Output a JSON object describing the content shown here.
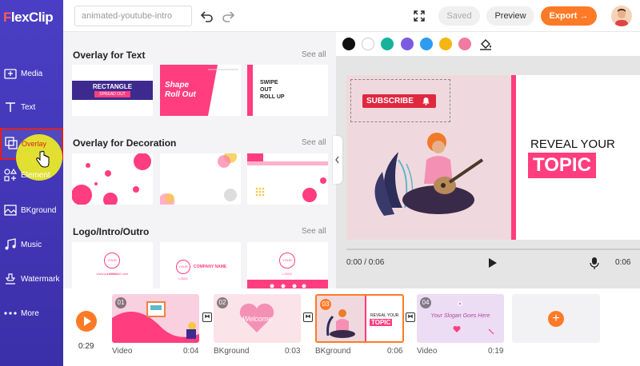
{
  "app": {
    "logo_f": "F",
    "logo_rest": "lexClip"
  },
  "sidebar": {
    "items": [
      {
        "label": "Media",
        "icon": "media-icon"
      },
      {
        "label": "Text",
        "icon": "text-icon"
      },
      {
        "label": "Overlay",
        "icon": "overlay-icon"
      },
      {
        "label": "Element",
        "icon": "element-icon"
      },
      {
        "label": "BKground",
        "icon": "background-icon"
      },
      {
        "label": "Music",
        "icon": "music-icon"
      },
      {
        "label": "Watermark",
        "icon": "watermark-icon"
      },
      {
        "label": "More",
        "icon": "more-icon"
      }
    ]
  },
  "toolbar": {
    "project_name": "animated-youtube-intro",
    "saved_label": "Saved",
    "preview_label": "Preview",
    "export_label": "Export",
    "export_arrow": "→"
  },
  "panel": {
    "sections": [
      {
        "title": "Overlay for Text",
        "see_all": "See all"
      },
      {
        "title": "Overlay for Decoration",
        "see_all": "See all"
      },
      {
        "title": "Logo/Intro/Outro",
        "see_all": "See all"
      }
    ],
    "text_thumbs": [
      {
        "line1": "RECTANGLE",
        "line2": "SPREAD OUT"
      },
      {
        "line1": "Shape",
        "line2": "Roll Out"
      },
      {
        "line1": "SWIPE",
        "line2": "OUT",
        "line3": "ROLL UP"
      }
    ],
    "logo_thumbs": [
      {
        "logo": "YOUR LOGO",
        "caption": "www.yourwebsite.com"
      },
      {
        "logo": "YOUR LOGO",
        "caption": "COMPANY NAME"
      },
      {
        "logo": "YOUR LOGO",
        "caption": ""
      }
    ]
  },
  "palette": {
    "colors": [
      "#111111",
      "#ffffff",
      "#15b39b",
      "#7b5ce0",
      "#2d9cf0",
      "#f5b512",
      "#f07aa0"
    ]
  },
  "stage": {
    "subscribe_label": "SUBSCRIBE",
    "heading_line1": "REVEAL YOUR",
    "heading_line2": "TOPIC"
  },
  "player": {
    "current_time": "0:00 / 0:06",
    "end_time": "0:06"
  },
  "timeline": {
    "total_time": "0:29",
    "clips": [
      {
        "num": "01",
        "label": "Video",
        "duration": "0:04"
      },
      {
        "num": "02",
        "label": "BKground",
        "duration": "0:03",
        "text": "Welcome"
      },
      {
        "num": "03",
        "label": "BKground",
        "duration": "0:06",
        "text1": "REVEAL YOUR",
        "text2": "TOPIC"
      },
      {
        "num": "04",
        "label": "Video",
        "duration": "0:19",
        "text": "Your Slogan Goes Here"
      }
    ],
    "add_label": "+"
  },
  "colors": {
    "accent": "#ff7a26",
    "brand": "#3b2fa9",
    "pink": "#ff3d7f"
  }
}
